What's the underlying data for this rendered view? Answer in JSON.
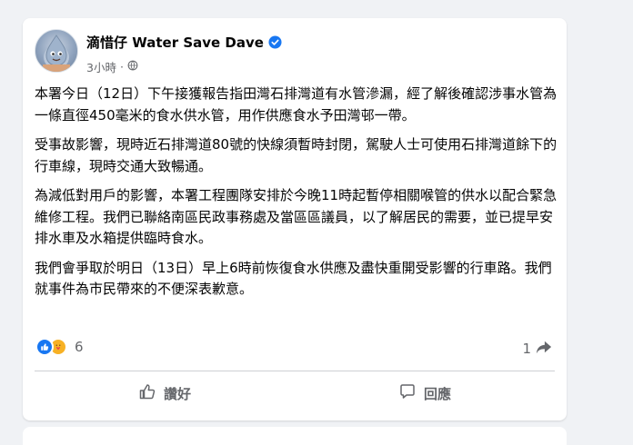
{
  "post": {
    "author_name": "滴惜仔 Water Save Dave",
    "timestamp": "3小時",
    "separator": "·",
    "audience_icon": "globe-icon",
    "verified_icon": "verified-badge-icon",
    "paragraphs": [
      "本署今日（12日）下午接獲報告指田灣石排灣道有水管滲漏，經了解後確認涉事水管為一條直徑450毫米的食水供水管，用作供應食水予田灣邨一帶。",
      "受事故影響，現時近石排灣道80號的快線須暫時封閉，駕駛人士可使用石排灣道餘下的行車線，現時交通大致暢通。",
      "為減低對用戶的影響，本署工程團隊安排於今晚11時起暫停相關喉管的供水以配合緊急維修工程。我們已聯絡南區民政事務處及當區區議員，以了解居民的需要，並已提早安排水車及水箱提供臨時食水。",
      "我們會爭取於明日（13日）早上6時前恢復食水供應及盡快重開受影響的行車路。我們就事件為市民帶來的不便深表歉意。"
    ],
    "reaction_count": "6",
    "share_count": "1",
    "colors": {
      "like_blue": "#1877f2",
      "care_yellow": "#f7b125",
      "secondary_text": "#65676b"
    }
  },
  "actions": {
    "like_label": "讚好",
    "comment_label": "回應"
  }
}
